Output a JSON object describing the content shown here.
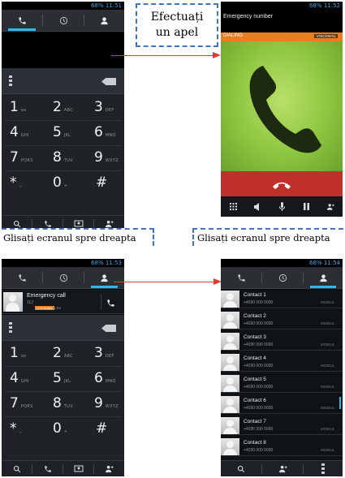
{
  "status": {
    "time_1": "68% 11:51",
    "time_2": "68% 11:52",
    "time_3": "68% 11:53",
    "time_4": "68% 11:54"
  },
  "callout_top": "Efectuați un apel",
  "caption_left": "Glisați ecranul spre dreapta",
  "caption_right": "Glisați ecranul spre dreapta",
  "dialpad_keys": [
    {
      "digit": "1",
      "letters": "ᴏᴏ"
    },
    {
      "digit": "2",
      "letters": "ABC"
    },
    {
      "digit": "3",
      "letters": "DEF"
    },
    {
      "digit": "4",
      "letters": "GHI"
    },
    {
      "digit": "5",
      "letters": "JKL"
    },
    {
      "digit": "6",
      "letters": "MNO"
    },
    {
      "digit": "7",
      "letters": "PQRS"
    },
    {
      "digit": "8",
      "letters": "TUV"
    },
    {
      "digit": "9",
      "letters": "WXYZ"
    },
    {
      "digit": "*",
      "letters": ",;"
    },
    {
      "digit": "0",
      "letters": "+"
    },
    {
      "digit": "#",
      "letters": ""
    }
  ],
  "calling": {
    "title": "Emergency number",
    "state": "DIALING",
    "badge": "VOICEMAIL"
  },
  "call_log": {
    "name": "Emergency call",
    "number": "112",
    "tag": "VOICEMAIL",
    "time": "11:52"
  },
  "contacts": [
    {
      "name": "Contact 1",
      "number": "+4030 000 0000",
      "type": "MOBILE"
    },
    {
      "name": "Contact 2",
      "number": "+4030 000 0000",
      "type": "MOBILE"
    },
    {
      "name": "Contact 3",
      "number": "+4030 000 0000",
      "type": "MOBILE"
    },
    {
      "name": "Contact 4",
      "number": "+4030 000 0000",
      "type": "MOBILE"
    },
    {
      "name": "Contact 5",
      "number": "+4030 000 0000",
      "type": "MOBILE"
    },
    {
      "name": "Contact 6",
      "number": "+4030 000 0000",
      "type": "MOBILE"
    },
    {
      "name": "Contact 7",
      "number": "+4030 000 0000",
      "type": "MOBILE"
    },
    {
      "name": "Contact 8",
      "number": "+4030 000 0000",
      "type": "MOBILE"
    }
  ],
  "colors": {
    "accent": "#33b5e5",
    "green": "#8cc63f",
    "red": "#c0302a",
    "arrow": "#e23a2e",
    "callout_border": "#3f76c3"
  },
  "icons": [
    "phone-icon",
    "clock-icon",
    "person-icon",
    "search-icon",
    "voicemail-icon",
    "add-contact-icon",
    "menu-icon",
    "backspace-icon",
    "end-call-icon",
    "dialpad-icon",
    "speaker-icon",
    "mute-icon",
    "pause-icon",
    "add-call-icon"
  ]
}
